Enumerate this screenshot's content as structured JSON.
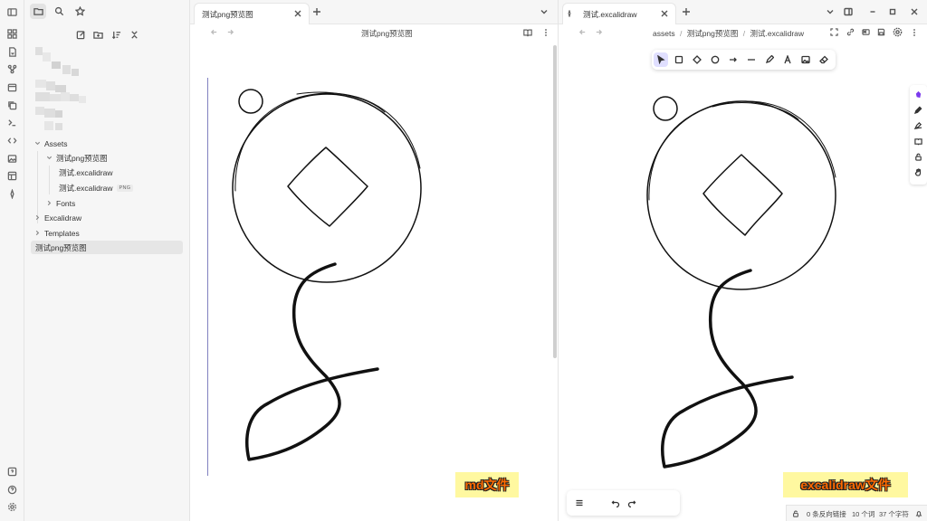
{
  "sidebar": {
    "tree": {
      "assets": "Assets",
      "preview_folder": "测试png预览图",
      "file_excalidraw": "测试.excalidraw",
      "file_excalidraw_png": "测试.excalidraw",
      "png_badge": "PNG",
      "fonts": "Fonts",
      "excalidraw": "Excalidraw",
      "templates": "Templates",
      "preview_note": "测试png预览图"
    }
  },
  "left_pane": {
    "tab_title": "测试png预览图",
    "nav_title": "测试png预览图",
    "label": "md文件"
  },
  "right_pane": {
    "tab_title": "测试.excalidraw",
    "breadcrumb": [
      "assets",
      "测试png预览图",
      "测试.excalidraw"
    ],
    "label": "excalidraw文件"
  },
  "status": {
    "backlinks": "0 条反向链接",
    "words": "10 个词",
    "chars": "37 个字符"
  },
  "colors": {
    "accent": "#6965db",
    "label_bg": "#fff8a0",
    "label_text": "#ff6a00"
  }
}
